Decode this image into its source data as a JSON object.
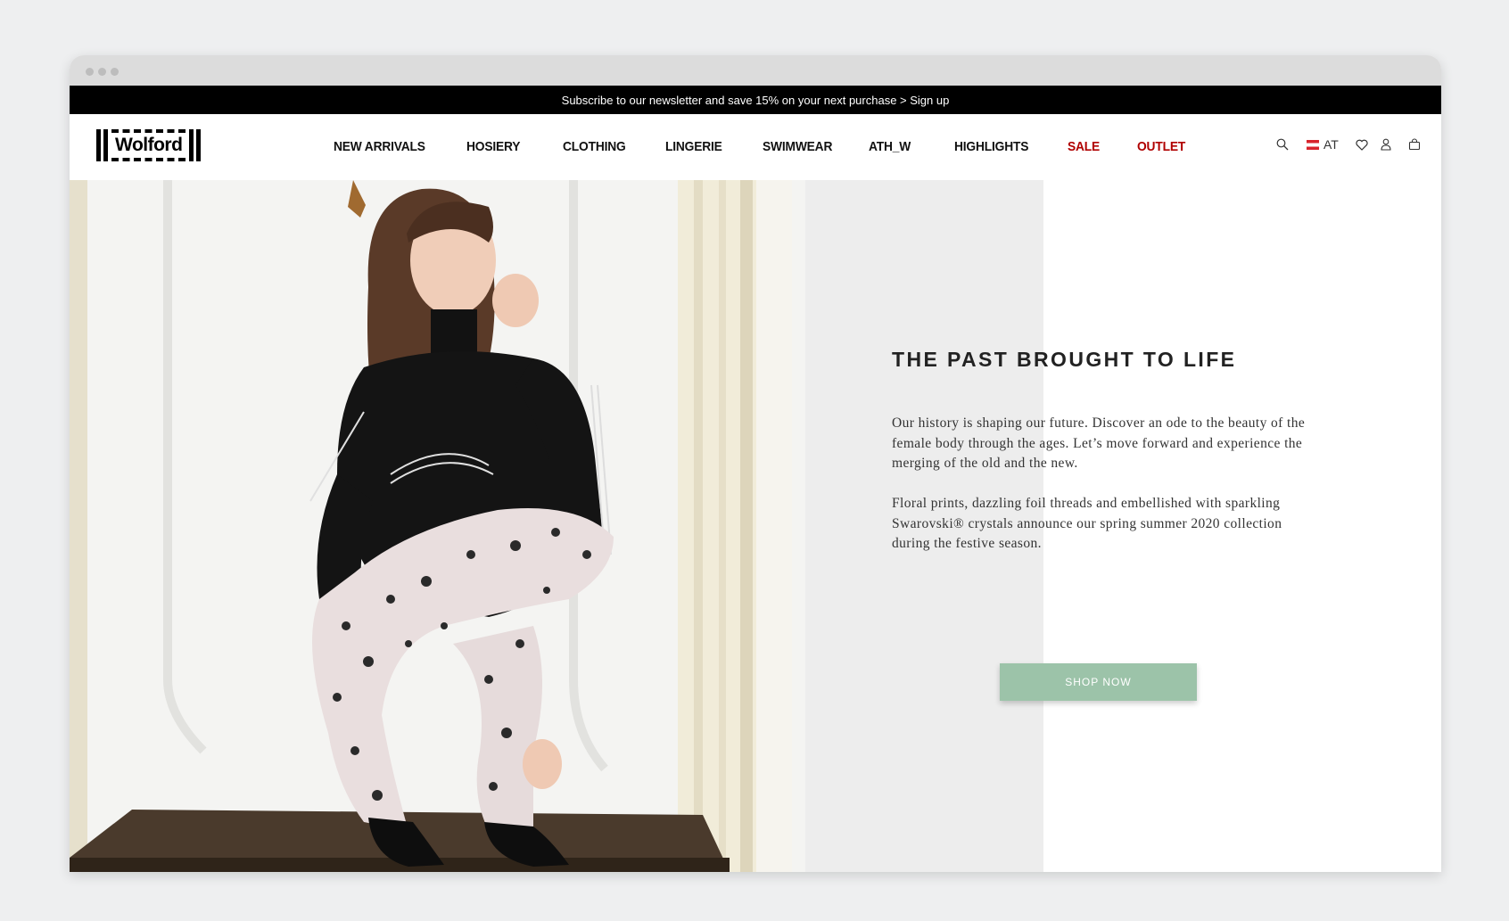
{
  "promo": {
    "text": "Subscribe to our newsletter and save 15% on your next purchase > Sign up"
  },
  "logo": {
    "text": "Wolford"
  },
  "nav": {
    "items": [
      {
        "label": "NEW ARRIVALS"
      },
      {
        "label": "HOSIERY"
      },
      {
        "label": "CLOTHING"
      },
      {
        "label": "LINGERIE"
      },
      {
        "label": "SWIMWEAR"
      },
      {
        "label": "ATH_W"
      },
      {
        "label": "HIGHLIGHTS"
      },
      {
        "label": "SALE",
        "color": "#b00000"
      },
      {
        "label": "OUTLET",
        "color": "#b00000"
      }
    ]
  },
  "utils": {
    "search_icon": "search-icon",
    "country": "AT",
    "wishlist_icon": "heart-icon",
    "account_icon": "user-icon",
    "cart_icon": "bag-icon"
  },
  "hero": {
    "title": "THE PAST BROUGHT TO LIFE",
    "paragraph1": "Our history is shaping our future. Discover an ode to the beauty of the female body through the ages. Let’s move forward and experience the merging of the old and the new.",
    "paragraph2": "Floral prints, dazzling foil threads and embellished with sparkling Swarovski® crystals announce our spring summer 2020 collection during the festive season.",
    "cta_label": "SHOP NOW",
    "cta_color": "#9cc3a9"
  }
}
